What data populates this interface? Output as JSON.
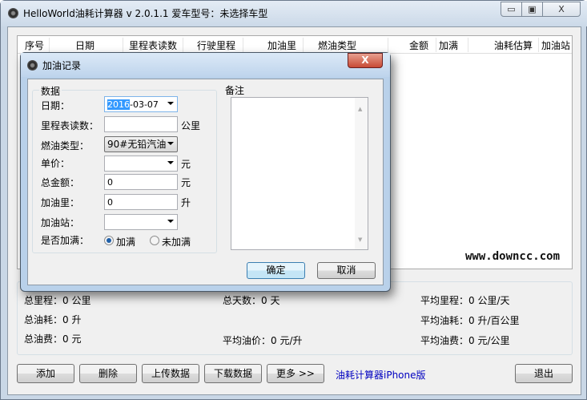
{
  "window": {
    "title": "HelloWorld油耗计算器 v 2.0.1.1  爱车型号：未选择车型",
    "minimize": "▭",
    "maximize": "▣",
    "close": "X"
  },
  "table": {
    "columns": [
      "序号",
      "日期",
      "里程表读数",
      "行驶里程",
      "加油里",
      "燃油类型",
      "金额",
      "加满",
      "油耗估算",
      "加油站"
    ]
  },
  "watermark": "www.downcc.com",
  "summary": {
    "total_distance": "总里程：0 公里",
    "total_days": "总天数：0 天",
    "avg_distance": "平均里程：0 公里/天",
    "total_fuel": "总油耗：0 升",
    "avg_fuel": "平均油耗：0 升/百公里",
    "total_cost": "总油费：0 元",
    "avg_price": "平均油价：0 元/升",
    "avg_cost": "平均油费：0 元/公里"
  },
  "buttons": {
    "add": "添加",
    "delete": "删除",
    "upload": "上传数据",
    "download": "下载数据",
    "more": "更多 >>",
    "exit": "退出"
  },
  "iphone_link": "油耗计算器iPhone版",
  "dialog": {
    "title": "加油记录",
    "close": "X",
    "group_data": "数据",
    "group_notes": "备注",
    "date_label": "日期：",
    "date_year": "2016",
    "date_rest": "-03-07",
    "odometer_label": "里程表读数：",
    "odometer_value": "",
    "odometer_unit": "公里",
    "fuel_type_label": "燃油类型：",
    "fuel_type_value": "90#无铅汽油",
    "unit_price_label": "单价：",
    "unit_price_value": "",
    "unit_price_unit": "元",
    "total_label": "总金额：",
    "total_value": "0",
    "total_unit": "元",
    "volume_label": "加油里：",
    "volume_value": "0",
    "volume_unit": "升",
    "station_label": "加油站：",
    "station_value": "",
    "full_label": "是否加满：",
    "full_option": "加满",
    "not_full_option": "未加满",
    "ok": "确定",
    "cancel": "取消"
  }
}
